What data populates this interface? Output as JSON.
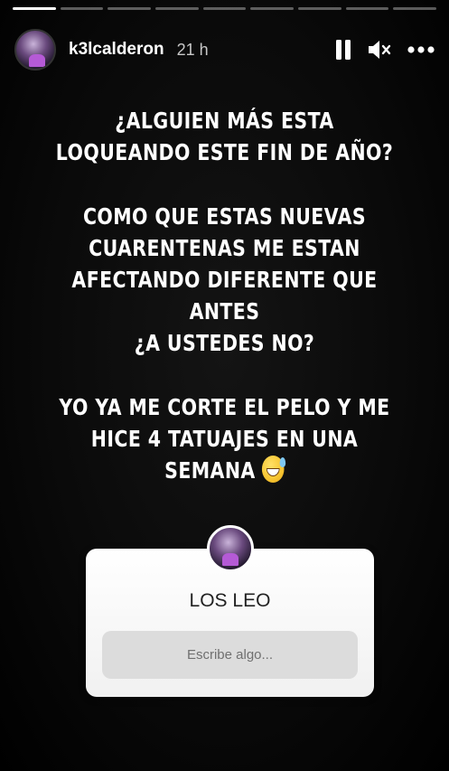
{
  "progress": {
    "segments": 9,
    "active_index": 0
  },
  "header": {
    "username": "k3lcalderon",
    "time": "21 h"
  },
  "story": {
    "paragraphs": [
      "¿ALGUIEN MÁS ESTA\nLOQUEANDO ESTE FIN DE AÑO?",
      "COMO QUE ESTAS NUEVAS\nCUARENTENAS ME ESTAN\nAFECTANDO DIFERENTE QUE\nANTES\n¿A USTEDES NO?",
      "YO YA ME CORTE EL PELO Y ME\nHICE 4 TATUAJES EN UNA\nSEMANA"
    ]
  },
  "question_sticker": {
    "title": "LOS LEO",
    "placeholder": "Escribe algo..."
  },
  "colors": {
    "background": "#0a0a0a",
    "text": "#ffffff",
    "card": "#ffffff",
    "answer_box": "#dcdcdc"
  },
  "icons": [
    "pause-icon",
    "mute-icon",
    "more-icon",
    "grinning-sweat-emoji"
  ]
}
